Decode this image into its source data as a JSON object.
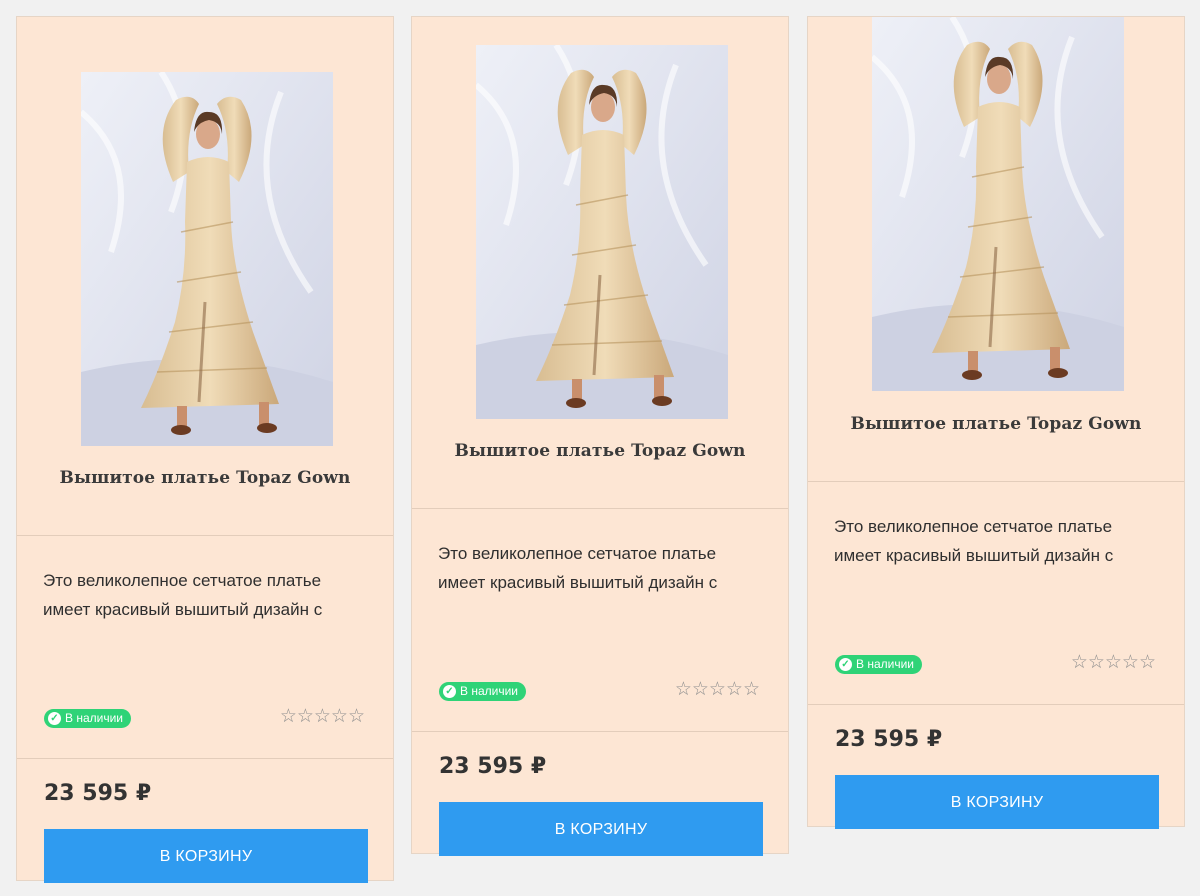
{
  "products": [
    {
      "title": "Вышитое платье Topaz Gown",
      "description": "Это великолепное сетчатое платье имеет красивый вышитый дизайн с",
      "stock_label": "В наличии",
      "rating": "☆☆☆☆☆",
      "price": "23  595  ₽",
      "cart_label": "В КОРЗИНУ"
    },
    {
      "title": "Вышитое платье Topaz Gown",
      "description": "Это великолепное сетчатое платье имеет красивый вышитый дизайн с",
      "stock_label": "В наличии",
      "rating": "☆☆☆☆☆",
      "price": "23  595  ₽",
      "cart_label": "В КОРЗИНУ"
    },
    {
      "title": "Вышитое платье Topaz Gown",
      "description": "Это великолепное сетчатое платье имеет красивый вышитый дизайн с",
      "stock_label": "В наличии",
      "rating": "☆☆☆☆☆",
      "price": "23  595  ₽",
      "cart_label": "В КОРЗИНУ"
    }
  ],
  "colors": {
    "card_bg": "#fde6d4",
    "page_bg": "#f1f1f1",
    "button": "#2f9bf0",
    "badge": "#2fd377"
  },
  "icons": {
    "stock": "check-circle-icon",
    "rating": "star-outline-icon"
  }
}
